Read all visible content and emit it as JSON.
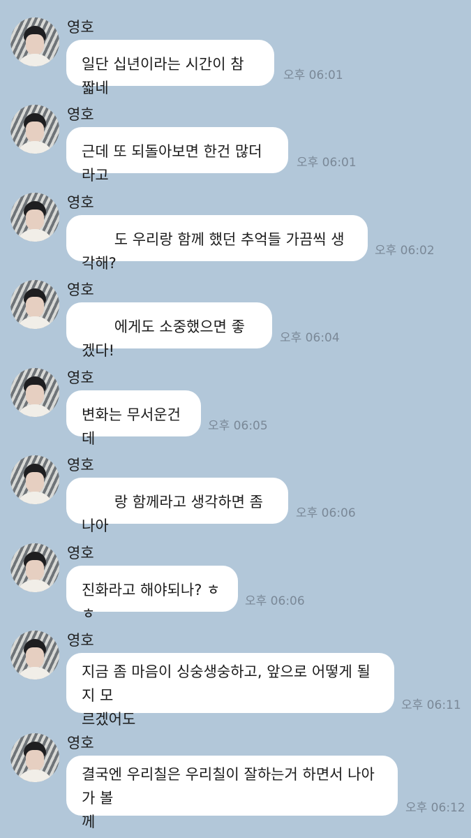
{
  "chat": {
    "messages": [
      {
        "sender": "영호",
        "text": "일단 십년이라는 시간이 참 짧네",
        "time": "오후 06:01"
      },
      {
        "sender": "영호",
        "text": "근데 또 되돌아보면 한건 많더라고",
        "time": "오후 06:01"
      },
      {
        "sender": "영호",
        "text": "       도 우리랑 함께 했던 추억들 가끔씩 생각해?",
        "time": "오후 06:02"
      },
      {
        "sender": "영호",
        "text": "       에게도 소중했으면 좋겠다!",
        "time": "오후 06:04"
      },
      {
        "sender": "영호",
        "text": "변화는 무서운건데",
        "time": "오후 06:05"
      },
      {
        "sender": "영호",
        "text": "       랑 함께라고 생각하면 좀 나아",
        "time": "오후 06:06"
      },
      {
        "sender": "영호",
        "text": "진화라고 해야되나? ㅎㅎ",
        "time": "오후 06:06"
      },
      {
        "sender": "영호",
        "text": "지금 좀 마음이 싱숭생숭하고, 앞으로 어떻게 될지 모\n르겠어도",
        "time": "오후 06:11"
      },
      {
        "sender": "영호",
        "text": "결국엔 우리칠은 우리칠이 잘하는거 하면서 나아가 볼\n께",
        "time": "오후 06:12"
      }
    ]
  }
}
